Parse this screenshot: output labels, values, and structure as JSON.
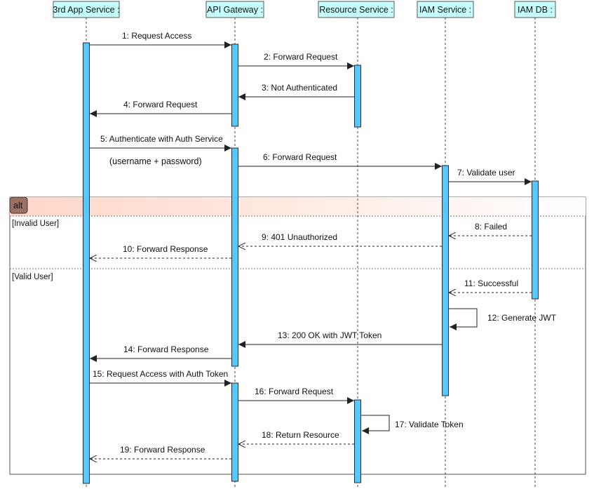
{
  "colors": {
    "lifeline_box_fill": "#c6ffff",
    "activation_fill": "#55c8ff",
    "activation_stroke": "#2a2a2a",
    "frame_header_fill": "#ffd6c8",
    "frame_tag_fill": "#9c7062",
    "frame_border": "#555555",
    "note_text": "#1a1ad6",
    "arrow": "#222222"
  },
  "lifelines": [
    {
      "id": "app",
      "label": "3rd App Service :"
    },
    {
      "id": "gateway",
      "label": "API Gateway :"
    },
    {
      "id": "resource",
      "label": "Resource Service :"
    },
    {
      "id": "iam",
      "label": "IAM Service :"
    },
    {
      "id": "iamdb",
      "label": "IAM DB :"
    }
  ],
  "messages": [
    {
      "label": "1: Request Access",
      "from": "app",
      "to": "gateway",
      "style": "sync"
    },
    {
      "label": "2: Forward Request",
      "from": "gateway",
      "to": "resource",
      "style": "sync"
    },
    {
      "label": "3: Not Authenticated",
      "from": "resource",
      "to": "gateway",
      "style": "sync"
    },
    {
      "label": "4: Forward Request",
      "from": "gateway",
      "to": "app",
      "style": "sync"
    },
    {
      "label": "5: Authenticate with Auth Service",
      "from": "app",
      "to": "gateway",
      "style": "sync"
    },
    {
      "label": "6: Forward Request",
      "from": "gateway",
      "to": "iam",
      "style": "sync"
    },
    {
      "label": "7: Validate user",
      "from": "iam",
      "to": "iamdb",
      "style": "sync"
    },
    {
      "label": "8: Failed",
      "from": "iamdb",
      "to": "iam",
      "style": "reply"
    },
    {
      "label": "9: 401 Unauthorized",
      "from": "iam",
      "to": "gateway",
      "style": "reply"
    },
    {
      "label": "10: Forward Response",
      "from": "gateway",
      "to": "app",
      "style": "reply"
    },
    {
      "label": "11: Successful",
      "from": "iamdb",
      "to": "iam",
      "style": "reply"
    },
    {
      "label": "12: Generate JWT",
      "from": "iam",
      "to": "iam",
      "style": "self"
    },
    {
      "label": "13: 200 OK with JWT Token",
      "from": "iam",
      "to": "gateway",
      "style": "sync"
    },
    {
      "label": "14: Forward Response",
      "from": "gateway",
      "to": "app",
      "style": "sync"
    },
    {
      "label": "15: Request Access with Auth Token",
      "from": "app",
      "to": "gateway",
      "style": "sync"
    },
    {
      "label": "16: Forward Request",
      "from": "gateway",
      "to": "resource",
      "style": "sync"
    },
    {
      "label": "17: Validate Token",
      "from": "resource",
      "to": "resource",
      "style": "self"
    },
    {
      "label": "18: Return Resource",
      "from": "resource",
      "to": "gateway",
      "style": "reply"
    },
    {
      "label": "19: Forward Response",
      "from": "gateway",
      "to": "app",
      "style": "reply"
    }
  ],
  "note": {
    "text": "(username + password)"
  },
  "alt_frame": {
    "operator": "alt",
    "guards": [
      "[Invalid User]",
      "[Valid User]"
    ]
  }
}
